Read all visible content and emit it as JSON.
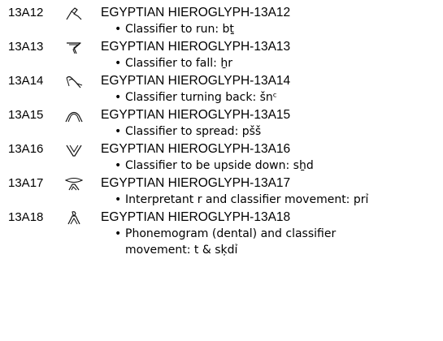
{
  "entries": [
    {
      "code": "13A12",
      "icon": "running-legs-classifier-icon",
      "name": "EGYPTIAN HIEROGLYPH-13A12",
      "note": "Classifier to run: bṯ"
    },
    {
      "code": "13A13",
      "icon": "falling-legs-classifier-icon",
      "name": "EGYPTIAN HIEROGLYPH-13A13",
      "note": "Classifier to fall: ẖr"
    },
    {
      "code": "13A14",
      "icon": "turning-back-legs-classifier-icon",
      "name": "EGYPTIAN HIEROGLYPH-13A14",
      "note": "Classifier turning back: šnᶜ"
    },
    {
      "code": "13A15",
      "icon": "spread-legs-classifier-icon",
      "name": "EGYPTIAN HIEROGLYPH-13A15",
      "note": "Classifier to spread: pšš"
    },
    {
      "code": "13A16",
      "icon": "upside-down-legs-classifier-icon",
      "name": "EGYPTIAN HIEROGLYPH-13A16",
      "note": "Classifier to be upside down: sẖd"
    },
    {
      "code": "13A17",
      "icon": "mouth-with-legs-icon",
      "name": "EGYPTIAN HIEROGLYPH-13A17",
      "note": "Interpretant r and classifier movement: prỉ"
    },
    {
      "code": "13A18",
      "icon": "bread-with-legs-icon",
      "name": "EGYPTIAN HIEROGLYPH-13A18",
      "note": "Phonemogram (dental) and classifier movement: t & sḳdỉ"
    }
  ]
}
